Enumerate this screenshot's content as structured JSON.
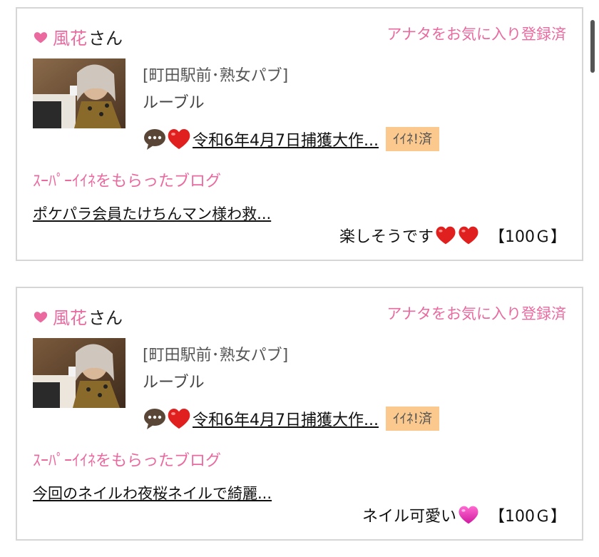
{
  "colors": {
    "accent_pink": "#ea6aa0",
    "like_badge_bg": "#fbc98e",
    "border": "#d6d6d6"
  },
  "cards": [
    {
      "name": "風花",
      "name_suffix": "さん",
      "favorite_status": "アナタをお気に入り登録済",
      "shop_area": "[町田駅前･熟女パブ]",
      "shop_name": "ルーブル",
      "post_title": "令和6年4月7日捕獲大作...",
      "like_badge": "ｲｲﾈ!済",
      "received_label": "ｽｰﾊﾟｰｲｲﾈをもらったブログ",
      "blog_title": "ポケパラ会員たけちんマン様わ救...",
      "comment": "楽しそうです",
      "comment_emojis": [
        "red-heart",
        "red-heart"
      ],
      "points": "【100Ｇ】"
    },
    {
      "name": "風花",
      "name_suffix": "さん",
      "favorite_status": "アナタをお気に入り登録済",
      "shop_area": "[町田駅前･熟女パブ]",
      "shop_name": "ルーブル",
      "post_title": "令和6年4月7日捕獲大作...",
      "like_badge": "ｲｲﾈ!済",
      "received_label": "ｽｰﾊﾟｰｲｲﾈをもらったブログ",
      "blog_title": "今回のネイルわ夜桜ネイルで綺麗...",
      "comment": "ネイル可愛い",
      "comment_emojis": [
        "pink-heart"
      ],
      "points": "【100Ｇ】"
    }
  ]
}
